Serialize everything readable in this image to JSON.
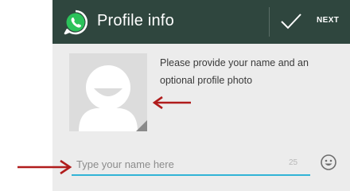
{
  "header": {
    "title": "Profile info",
    "next_label": "NEXT",
    "logo_icon": "whatsapp-logo-icon",
    "confirm_icon": "checkmark-icon",
    "bar_color": "#2f463e"
  },
  "profile": {
    "hint": "Please provide your name and an optional profile photo",
    "photo_icon": "default-avatar-icon"
  },
  "name_field": {
    "placeholder": "Type your name here",
    "value": "",
    "char_count": "25",
    "emoji_icon": "smiley-icon",
    "accent_color": "#32b4d6"
  },
  "annotations": {
    "arrow_color": "#b01c1c"
  }
}
